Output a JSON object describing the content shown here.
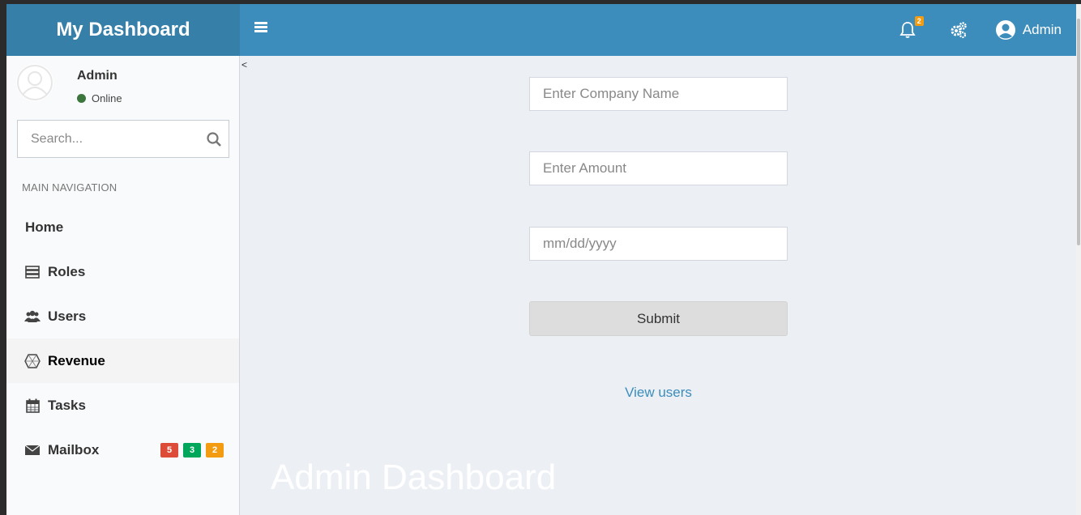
{
  "header": {
    "brand": "My Dashboard",
    "notifications_count": "2",
    "user_label": "Admin"
  },
  "sidebar": {
    "user_name": "Admin",
    "status": "Online",
    "search_placeholder": "Search...",
    "nav_header": "MAIN NAVIGATION",
    "items": [
      {
        "label": "Home",
        "icon": "none"
      },
      {
        "label": "Roles",
        "icon": "server-icon"
      },
      {
        "label": "Users",
        "icon": "users-icon"
      },
      {
        "label": "Revenue",
        "icon": "cube-icon",
        "active": true
      },
      {
        "label": "Tasks",
        "icon": "calendar-icon"
      },
      {
        "label": "Mailbox",
        "icon": "envelope-icon",
        "badges": [
          "5",
          "3",
          "2"
        ]
      }
    ],
    "badge_colors": [
      "#dd4b39",
      "#00a65a",
      "#f39c12"
    ]
  },
  "content": {
    "collapse_glyph": "<",
    "company_placeholder": "Enter Company Name",
    "amount_placeholder": "Enter Amount",
    "date_placeholder": "mm/dd/yyyy",
    "submit_label": "Submit",
    "view_users_link": "View users",
    "watermark": "Admin Dashboard"
  },
  "colors": {
    "header_logo_bg": "#367fa9",
    "header_bg": "#3c8dbc",
    "content_bg": "#ecf0f5",
    "link": "#3c8dbc",
    "online": "#3c763d"
  }
}
